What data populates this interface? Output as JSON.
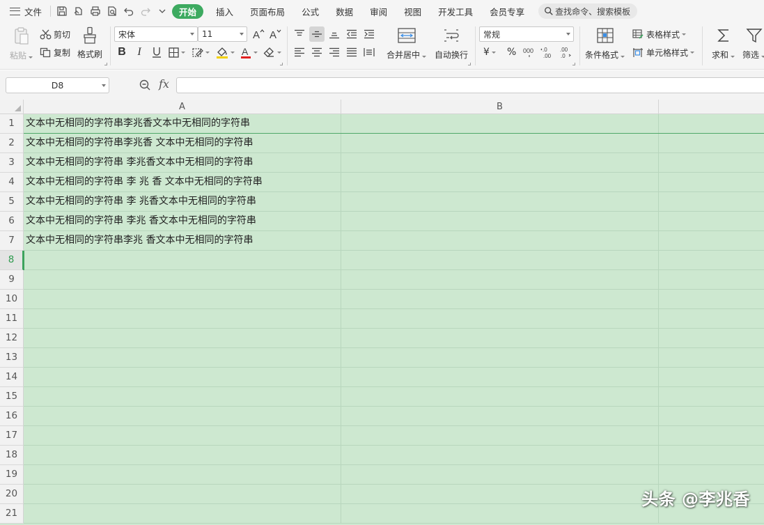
{
  "menubar": {
    "file_label": "文件",
    "tabs": [
      {
        "label": "开始",
        "active": true
      },
      {
        "label": "插入"
      },
      {
        "label": "页面布局"
      },
      {
        "label": "公式"
      },
      {
        "label": "数据"
      },
      {
        "label": "审阅"
      },
      {
        "label": "视图"
      },
      {
        "label": "开发工具"
      },
      {
        "label": "会员专享"
      }
    ],
    "search_label": "查找命令、搜索模板",
    "accent_color": "#3daa60"
  },
  "ribbon": {
    "paste": "粘贴",
    "cut": "剪切",
    "copy": "复制",
    "format_painter": "格式刷",
    "font_name": "宋体",
    "font_size": "11",
    "merge_center": "合并居中",
    "wrap_text": "自动换行",
    "number_format": "常规",
    "currency_symbol": "¥",
    "percent_symbol": "%",
    "conditional_format": "条件格式",
    "table_style": "表格样式",
    "cell_style": "单元格样式",
    "sum": "求和",
    "filter": "筛选"
  },
  "formula_bar": {
    "cell_ref": "D8",
    "fx": "fx",
    "formula": ""
  },
  "sheet": {
    "columns": [
      "A",
      "B"
    ],
    "active_row": "8",
    "rows": [
      {
        "num": "1",
        "a": "文本中无相同的字符串李兆香文本中无相同的字符串"
      },
      {
        "num": "2",
        "a": "文本中无相同的字符串李兆香 文本中无相同的字符串"
      },
      {
        "num": "3",
        "a": "文本中无相同的字符串 李兆香文本中无相同的字符串"
      },
      {
        "num": "4",
        "a": "文本中无相同的字符串 李 兆 香 文本中无相同的字符串"
      },
      {
        "num": "5",
        "a": "文本中无相同的字符串 李 兆香文本中无相同的字符串"
      },
      {
        "num": "6",
        "a": "文本中无相同的字符串 李兆 香文本中无相同的字符串"
      },
      {
        "num": "7",
        "a": "文本中无相同的字符串李兆 香文本中无相同的字符串"
      },
      {
        "num": "8",
        "a": ""
      },
      {
        "num": "9",
        "a": ""
      },
      {
        "num": "10",
        "a": ""
      },
      {
        "num": "11",
        "a": ""
      },
      {
        "num": "12",
        "a": ""
      },
      {
        "num": "13",
        "a": ""
      },
      {
        "num": "14",
        "a": ""
      },
      {
        "num": "15",
        "a": ""
      },
      {
        "num": "16",
        "a": ""
      },
      {
        "num": "17",
        "a": ""
      },
      {
        "num": "18",
        "a": ""
      },
      {
        "num": "19",
        "a": ""
      },
      {
        "num": "20",
        "a": ""
      },
      {
        "num": "21",
        "a": ""
      }
    ],
    "fill_color": "#cde8d0"
  },
  "watermark": "头条 @李兆香"
}
